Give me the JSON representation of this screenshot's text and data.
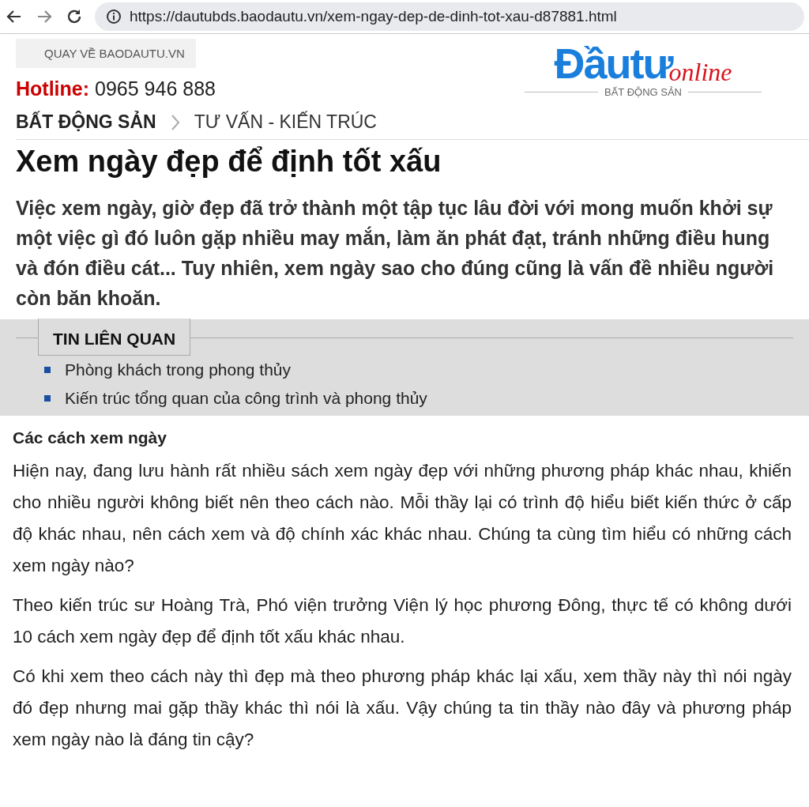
{
  "browser": {
    "url": "https://dautubds.baodautu.vn/xem-ngay-dep-de-dinh-tot-xau-d87881.html"
  },
  "header": {
    "back_link": "QUAY VỀ BAODAUTU.VN",
    "hotline_label": "Hotline:",
    "hotline_number": "0965 946 888",
    "logo": {
      "main": "Đầutư",
      "script": "online",
      "tagline": "BẤT ĐỘNG SẢN"
    }
  },
  "breadcrumb": [
    "BẤT ĐỘNG SẢN",
    "TƯ VẤN - KIẾN TRÚC"
  ],
  "article": {
    "title": "Xem ngày đẹp để định tốt xấu",
    "lead": "Việc xem ngày, giờ đẹp đã trở thành một tập tục lâu đời với mong muốn khởi sự một việc gì đó luôn gặp nhiều may mắn, làm ăn phát đạt, tránh những điều hung và đón điều cát... Tuy nhiên, xem ngày sao cho đúng cũng là vấn đề nhiều người còn băn khoăn.",
    "related": {
      "heading": "TIN LIÊN QUAN",
      "items": [
        "Phòng khách trong phong thủy",
        "Kiến trúc tổng quan của công trình và phong thủy"
      ]
    },
    "subheading": "Các cách xem ngày",
    "paragraphs": [
      "Hiện nay, đang lưu hành rất nhiều sách xem ngày đẹp với những phương pháp khác nhau, khiến cho nhiều người không biết nên theo cách nào. Mỗi thầy lại có trình độ hiểu biết kiến thức ở cấp độ khác nhau, nên cách xem và độ chính xác khác nhau. Chúng ta cùng tìm hiểu có những cách xem ngày nào?",
      "Theo kiến trúc sư Hoàng Trà, Phó viện trưởng Viện lý học phương Đông, thực tế có không dưới 10 cách xem ngày đẹp để định tốt xấu khác nhau.",
      "Có khi xem theo cách này thì đẹp mà theo phương pháp khác lại xấu, xem thầy này thì nói ngày đó đẹp nhưng mai gặp thầy khác thì nói là xấu. Vậy chúng ta tin thầy nào đây và phương pháp xem ngày nào là đáng tin cậy?"
    ]
  }
}
